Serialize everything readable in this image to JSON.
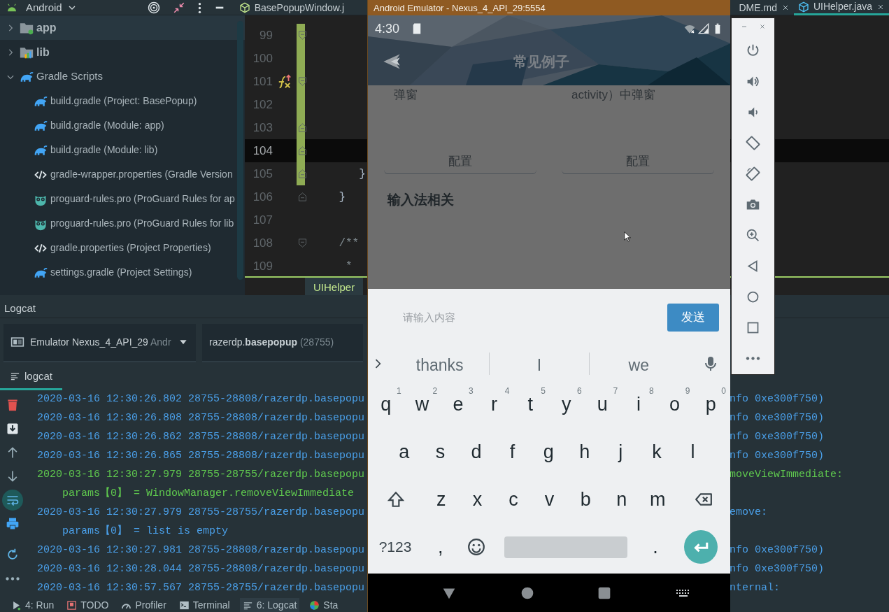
{
  "toolbar": {
    "project_view": "Android",
    "left_tabs": [
      {
        "label": "BasePopupWindow.j",
        "selected": false
      }
    ],
    "right_tabs": [
      {
        "label": "DME.md",
        "selected": false
      },
      {
        "label": "UIHelper.java",
        "selected": true
      }
    ]
  },
  "project_tree": [
    {
      "label": "app",
      "kind": "module",
      "expanded": false,
      "selected": true
    },
    {
      "label": "lib",
      "kind": "library",
      "expanded": false,
      "selected": false
    },
    {
      "label": "Gradle Scripts",
      "kind": "gradle",
      "expanded": true,
      "selected": false,
      "children": [
        {
          "label": "build.gradle (Project: BasePopup)",
          "kind": "gradle",
          "selected": false
        },
        {
          "label": "build.gradle (Module: app)",
          "kind": "gradle",
          "selected": false
        },
        {
          "label": "build.gradle (Module: lib)",
          "kind": "gradle",
          "selected": false
        },
        {
          "label": "gradle-wrapper.properties (Gradle Version",
          "kind": "properties",
          "selected": false
        },
        {
          "label": "proguard-rules.pro (ProGuard Rules for ap",
          "kind": "proguard",
          "selected": false
        },
        {
          "label": "proguard-rules.pro (ProGuard Rules for lib",
          "kind": "proguard",
          "selected": false
        },
        {
          "label": "gradle.properties (Project Properties)",
          "kind": "properties",
          "selected": false
        },
        {
          "label": "settings.gradle (Project Settings)",
          "kind": "gradle",
          "selected": false
        }
      ]
    }
  ],
  "editor": {
    "lines": [
      {
        "number": "99",
        "kind": "opener",
        "changed": true,
        "current": false,
        "marked": false
      },
      {
        "number": "100",
        "kind": "plain",
        "changed": true,
        "current": false,
        "marked": false
      },
      {
        "number": "101",
        "kind": "opener",
        "changed": true,
        "current": false,
        "marked": true
      },
      {
        "number": "102",
        "kind": "plain",
        "changed": true,
        "current": false,
        "marked": false
      },
      {
        "number": "103",
        "kind": "closer",
        "changed": true,
        "current": false,
        "marked": false
      },
      {
        "number": "104",
        "kind": "closer",
        "changed": true,
        "current": true,
        "marked": false
      },
      {
        "number": "105",
        "kind": "closer",
        "changed": true,
        "current": false,
        "marked": false,
        "code": "       }"
      },
      {
        "number": "106",
        "kind": "closer",
        "changed": false,
        "current": false,
        "marked": false,
        "code": "    }"
      },
      {
        "number": "107",
        "kind": "plain",
        "changed": false,
        "current": false,
        "marked": false
      },
      {
        "number": "108",
        "kind": "opener",
        "changed": false,
        "current": false,
        "marked": false,
        "code": "    /**"
      },
      {
        "number": "109",
        "kind": "plain",
        "changed": false,
        "current": false,
        "marked": false,
        "code": "     *"
      }
    ],
    "breadcrumb": "UIHelper"
  },
  "logcat": {
    "title": "Logcat",
    "device": "Emulator Nexus_4_API_29",
    "device_detail": "Andr",
    "package": "razerdp.**basepopup**",
    "pid": "(28755)",
    "tab": "logcat",
    "tools": [
      {
        "kind": "clear",
        "selected": false
      },
      {
        "kind": "scroll-end",
        "selected": false
      },
      {
        "kind": "up",
        "selected": false
      },
      {
        "kind": "down",
        "selected": false
      },
      {
        "kind": "wrap",
        "selected": true
      },
      {
        "kind": "print",
        "selected": false
      },
      {
        "kind": "restart",
        "selected": false
      },
      {
        "kind": "more",
        "selected": false
      }
    ],
    "lines": [
      {
        "kind": "entry",
        "start": "2020-03-16 12:30:26.802 28755-28808/razerdp.basepopu",
        "end": "nfo 0xe300f750)",
        "color": "#4a9fe8"
      },
      {
        "kind": "entry",
        "start": "2020-03-16 12:30:26.808 28755-28808/razerdp.basepopu",
        "end": "nfo 0xe300f750)",
        "color": "#4a9fe8"
      },
      {
        "kind": "entry",
        "start": "2020-03-16 12:30:26.862 28755-28808/razerdp.basepopu",
        "end": "nfo 0xe300f750)",
        "color": "#4a9fe8"
      },
      {
        "kind": "entry",
        "start": "2020-03-16 12:30:26.865 28755-28808/razerdp.basepopu",
        "end": "nfo 0xe300f750)",
        "color": "#4a9fe8"
      },
      {
        "kind": "entry",
        "start": "2020-03-16 12:30:27.979 28755-28755/razerdp.basepopu",
        "end": "moveViewImmediate:",
        "color": "#5fc84e"
      },
      {
        "kind": "continuation",
        "start": "params【0】 = WindowManager.removeViewImmediate",
        "color": "#5fc84e"
      },
      {
        "kind": "entry",
        "start": "2020-03-16 12:30:27.979 28755-28755/razerdp.basepopu",
        "end": "emove:",
        "color": "#4a9fe8"
      },
      {
        "kind": "continuation",
        "start": "params【0】 = list is empty",
        "color": "#4a9fe8"
      },
      {
        "kind": "entry",
        "start": "2020-03-16 12:30:27.981 28755-28808/razerdp.basepopu",
        "end": "nfo 0xe300f750)",
        "color": "#4a9fe8"
      },
      {
        "kind": "entry",
        "start": "2020-03-16 12:30:28.044 28755-28808/razerdp.basepopu",
        "end": "nfo 0xe300f750)",
        "color": "#4a9fe8"
      },
      {
        "kind": "entry",
        "start": "2020-03-16 12:30:57.567 28755-28755/razerdp.basepopu",
        "end": "nternal:",
        "color": "#4a9fe8"
      }
    ]
  },
  "bottom_tools": [
    {
      "kind": "run",
      "label": "4: Run",
      "selected": false
    },
    {
      "kind": "todo",
      "label": "TODO",
      "selected": false
    },
    {
      "kind": "profiler",
      "label": "Profiler",
      "selected": false
    },
    {
      "kind": "terminal",
      "label": "Terminal",
      "selected": false
    },
    {
      "kind": "logcat",
      "label": "6: Logcat",
      "selected": true
    },
    {
      "kind": "studio",
      "label": "Sta",
      "selected": false
    }
  ],
  "emulator": {
    "title": "Android Emulator - Nexus_4_API_29:5554",
    "time": "4:30",
    "app_title": "常见例子",
    "cards": [
      {
        "text": "弹窗",
        "button": "配置"
      },
      {
        "text": "activity）中弹窗",
        "button": "配置"
      }
    ],
    "section": "输入法相关",
    "input": {
      "placeholder": "请输入内容",
      "button": "发送"
    },
    "suggestions": [
      "thanks",
      "I",
      "we"
    ],
    "keyboard": [
      [
        {
          "kind": "letter",
          "label": "q",
          "hint": "1"
        },
        {
          "kind": "letter",
          "label": "w",
          "hint": "2"
        },
        {
          "kind": "letter",
          "label": "e",
          "hint": "3"
        },
        {
          "kind": "letter",
          "label": "r",
          "hint": "4"
        },
        {
          "kind": "letter",
          "label": "t",
          "hint": "5"
        },
        {
          "kind": "letter",
          "label": "y",
          "hint": "6"
        },
        {
          "kind": "letter",
          "label": "u",
          "hint": "7"
        },
        {
          "kind": "letter",
          "label": "i",
          "hint": "8"
        },
        {
          "kind": "letter",
          "label": "o",
          "hint": "9"
        },
        {
          "kind": "letter",
          "label": "p",
          "hint": "0"
        }
      ],
      [
        {
          "kind": "letter",
          "label": "a"
        },
        {
          "kind": "letter",
          "label": "s"
        },
        {
          "kind": "letter",
          "label": "d"
        },
        {
          "kind": "letter",
          "label": "f"
        },
        {
          "kind": "letter",
          "label": "g"
        },
        {
          "kind": "letter",
          "label": "h"
        },
        {
          "kind": "letter",
          "label": "j"
        },
        {
          "kind": "letter",
          "label": "k"
        },
        {
          "kind": "letter",
          "label": "l"
        }
      ],
      [
        {
          "kind": "shift"
        },
        {
          "kind": "letter",
          "label": "z"
        },
        {
          "kind": "letter",
          "label": "x"
        },
        {
          "kind": "letter",
          "label": "c"
        },
        {
          "kind": "letter",
          "label": "v"
        },
        {
          "kind": "letter",
          "label": "b"
        },
        {
          "kind": "letter",
          "label": "n"
        },
        {
          "kind": "letter",
          "label": "m"
        },
        {
          "kind": "backspace"
        }
      ],
      [
        {
          "kind": "symbols",
          "label": "?123"
        },
        {
          "kind": "letter",
          "label": ","
        },
        {
          "kind": "emoji"
        },
        {
          "kind": "space"
        },
        {
          "kind": "letter",
          "label": "."
        },
        {
          "kind": "enter"
        }
      ]
    ]
  }
}
